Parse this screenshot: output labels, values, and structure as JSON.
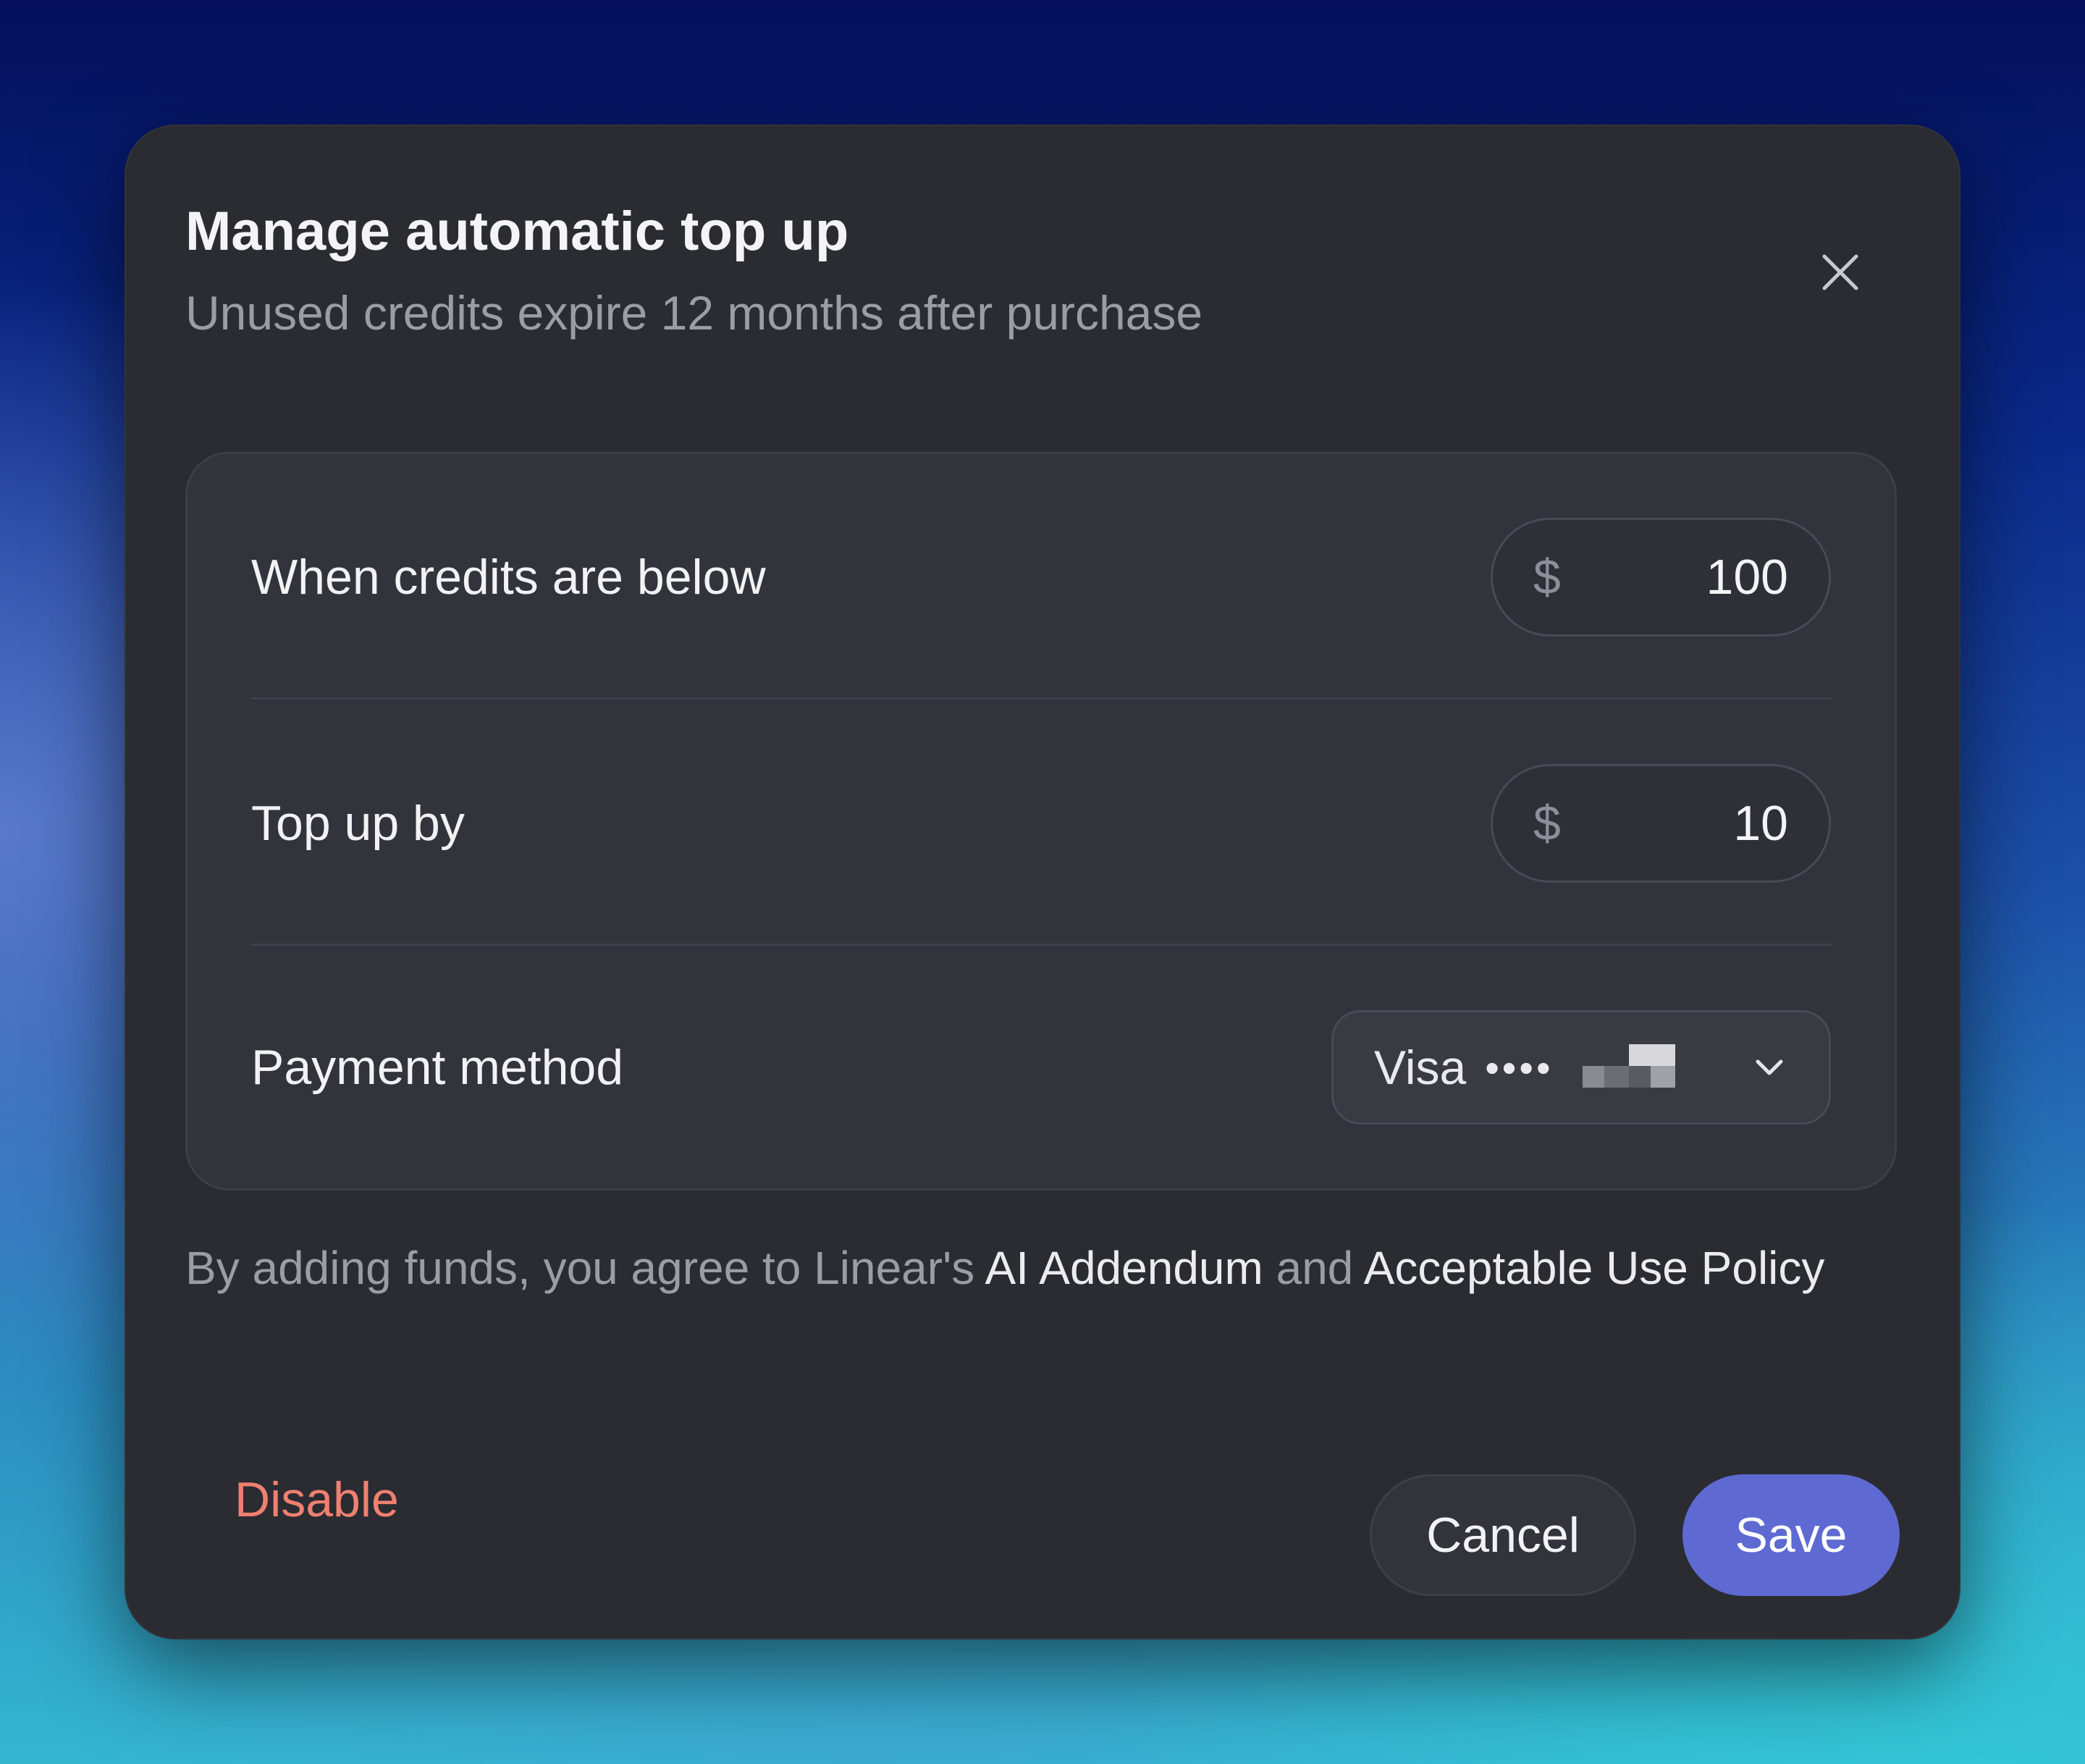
{
  "dialog": {
    "title": "Manage automatic top up",
    "subtitle": "Unused credits expire 12 months after purchase",
    "close_icon": "close-icon"
  },
  "settings": {
    "threshold": {
      "label": "When credits are below",
      "currency": "$",
      "value": "100"
    },
    "top_up": {
      "label": "Top up by",
      "currency": "$",
      "value": "10"
    },
    "payment": {
      "label": "Payment method",
      "brand": "Visa",
      "masked_dots": "••••",
      "last4_redacted": true,
      "dropdown_icon": "chevron-down-icon"
    }
  },
  "legal": {
    "prefix": "By adding funds, you agree to Linear's ",
    "link1": "AI Addendum",
    "middle": " and ",
    "link2": "Acceptable Use Policy"
  },
  "actions": {
    "disable": "Disable",
    "cancel": "Cancel",
    "save": "Save"
  },
  "colors": {
    "accent": "#5e6ad2",
    "danger": "#f08070",
    "dialog_bg": "#2b2b32"
  }
}
